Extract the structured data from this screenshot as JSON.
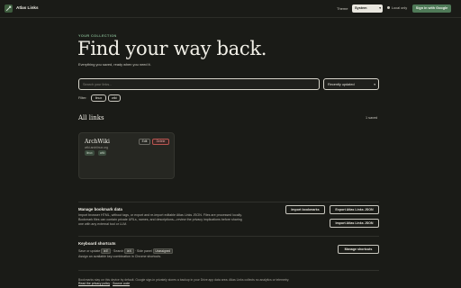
{
  "header": {
    "app_title": "Atlas Links",
    "logo_icon": "link-icon",
    "theme_label": "Theme",
    "theme_value": "System",
    "local_status": "Local only",
    "signin_label": "Sign in with Google"
  },
  "hero": {
    "eyebrow": "YOUR COLLECTION",
    "title": "Find your way back.",
    "subtitle": "Everything you saved, ready when you need it."
  },
  "search": {
    "placeholder": "Search your links...",
    "sort_value": "Recently updated"
  },
  "filters": {
    "label": "Filter:",
    "chips": [
      "linux",
      "wiki"
    ]
  },
  "links": {
    "heading": "All links",
    "count": "1 saved",
    "items": [
      {
        "title": "ArchWiki",
        "url": "wiki.archlinux.org",
        "tags": [
          "linux",
          "wiki"
        ],
        "edit_label": "Edit",
        "delete_label": "Delete"
      }
    ]
  },
  "manage": {
    "heading": "Manage bookmark data",
    "description": "Import browser HTML, without tags, or export and re-import editable Atlas Links JSON. Files are processed locally. Bookmark files can contain private URLs, names, and descriptions—review the privacy implications before sharing one with any external tool or LLM.",
    "import_label": "Import bookmarks",
    "export_label": "Export Atlas Links JSON",
    "import_json_label": "Import Atlas Links JSON"
  },
  "shortcuts": {
    "heading": "Keyboard shortcuts",
    "save_text": "Save or update",
    "save_key": "⌘E",
    "search_text": "Search",
    "search_key": "⌘K",
    "side_panel_text": "Side panel",
    "side_panel_key": "Unassigned",
    "assign_text": "Assign an available key combination in Chrome shortcuts.",
    "manage_label": "Manage shortcuts"
  },
  "footer": {
    "text": "Bookmarks stay on this device by default. Google sign-in privately stores a backup in your Drive app data area. Atlas Links collects no analytics or telemetry.",
    "privacy_link": "Read the privacy policy",
    "source_link": "Source code"
  },
  "colors": {
    "background": "#1a1b17",
    "accent": "#4f7a58",
    "eyebrow": "#7fae8a",
    "danger": "#b85550"
  }
}
